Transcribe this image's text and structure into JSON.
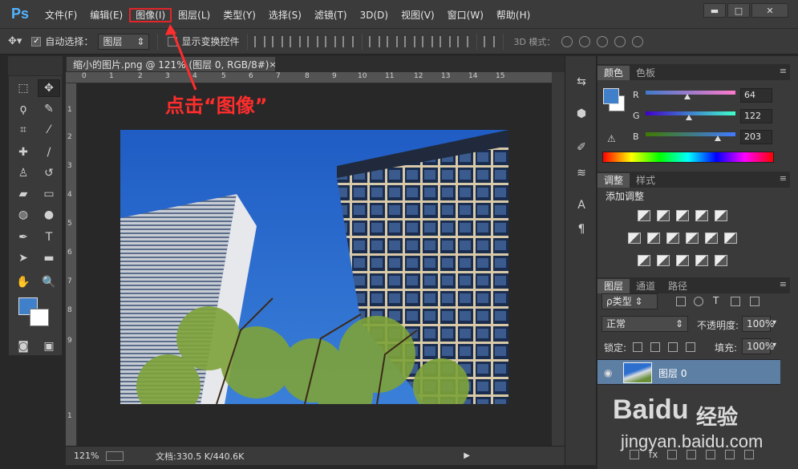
{
  "app": {
    "logo": "Ps"
  },
  "menu": [
    {
      "label": "文件(F)"
    },
    {
      "label": "编辑(E)"
    },
    {
      "label": "图像(I)"
    },
    {
      "label": "图层(L)"
    },
    {
      "label": "类型(Y)"
    },
    {
      "label": "选择(S)"
    },
    {
      "label": "滤镜(T)"
    },
    {
      "label": "3D(D)"
    },
    {
      "label": "视图(V)"
    },
    {
      "label": "窗口(W)"
    },
    {
      "label": "帮助(H)"
    }
  ],
  "window_controls": {
    "minimize": "▬",
    "maximize": "□",
    "close": "✕"
  },
  "options": {
    "auto_select_label": "自动选择：",
    "auto_select_checked": true,
    "auto_select_value": "图层",
    "show_transform_label": "显示变换控件",
    "show_transform_checked": false,
    "mode_3d_label": "3D 模式："
  },
  "document": {
    "tab_title": "缩小的图片.png @ 121% (图层 0, RGB/8#)",
    "tab_close": "×",
    "ruler_top": [
      "0",
      "1",
      "2",
      "3",
      "4",
      "5",
      "6",
      "7",
      "8",
      "9",
      "10",
      "11",
      "12",
      "13",
      "14",
      "15"
    ],
    "ruler_left": [
      "1",
      "2",
      "3",
      "4",
      "5",
      "6",
      "7",
      "8",
      "9",
      "1"
    ],
    "zoom": "121%",
    "doc_info": "文档:330.5 K/440.6K"
  },
  "annotation": {
    "text": "点击“图像”",
    "color": "#ff2d2d"
  },
  "color_panel": {
    "tabs": [
      "颜色",
      "色板"
    ],
    "channels": [
      {
        "name": "R",
        "value": "64"
      },
      {
        "name": "G",
        "value": "122"
      },
      {
        "name": "B",
        "value": "203"
      }
    ],
    "foreground": "#4080cb",
    "background": "#ffffff"
  },
  "adjust_panel": {
    "tabs": [
      "调整",
      "样式"
    ],
    "title": "添加调整"
  },
  "layers_panel": {
    "tabs": [
      "图层",
      "通道",
      "路径"
    ],
    "filter_type": "ρ类型",
    "blend_mode": "正常",
    "opacity_label": "不透明度:",
    "opacity_value": "100%",
    "lock_label": "锁定:",
    "fill_label": "填充:",
    "fill_value": "100%",
    "layers": [
      {
        "name": "图层 0",
        "visible": true,
        "selected": true
      }
    ],
    "footer_fx": "fx"
  },
  "watermark": {
    "brand": "Bai",
    "paw": "du",
    "cn": "经验",
    "url": "jingyan.baidu.com"
  }
}
